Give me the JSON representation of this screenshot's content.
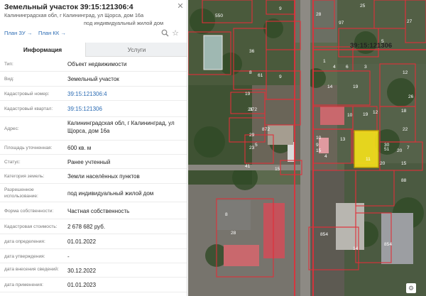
{
  "header": {
    "title": "Земельный участок 39:15:121306:4",
    "address_line1": "Калининградская обл, г Калининград, ул Щорса, дом 16а",
    "address_line2": "под индивидуальный жилой дом",
    "link_plan_zu": "План ЗУ →",
    "link_plan_kk": "План КК →"
  },
  "icons": {
    "close": "close-icon",
    "edit": "edit-icon",
    "star": "star-icon",
    "search": "search-icon"
  },
  "tabs": {
    "info": "Информация",
    "services": "Услуги"
  },
  "rows": [
    {
      "label": "Тип:",
      "value": "Объект недвижимости",
      "link": false
    },
    {
      "label": "Вид:",
      "value": "Земельный участок",
      "link": false
    },
    {
      "label": "Кадастровый номер:",
      "value": "39:15:121306:4",
      "link": true
    },
    {
      "label": "Кадастровый квартал:",
      "value": "39:15:121306",
      "link": true
    },
    {
      "label": "Адрес:",
      "value": "Калининградская обл, г Калининград, ул Щорса, дом 16а",
      "link": false
    },
    {
      "label": "Площадь уточненная:",
      "value": "600 кв. м",
      "link": false
    },
    {
      "label": "Статус:",
      "value": "Ранее учтенный",
      "link": false
    },
    {
      "label": "Категория земель:",
      "value": "Земли населённых пунктов",
      "link": false
    },
    {
      "label": "Разрешенное использование:",
      "value": "под индивидуальный жилой дом",
      "link": false
    },
    {
      "label": "Форма собственности:",
      "value": "Частная собственность",
      "link": false
    },
    {
      "label": "Кадастровая стоимость:",
      "value": "2 678 682 руб.",
      "link": false
    },
    {
      "label": "дата определения:",
      "value": "01.01.2022",
      "link": false
    },
    {
      "label": "дата утверждения:",
      "value": "-",
      "link": false
    },
    {
      "label": "дата внесения сведений:",
      "value": "30.12.2022",
      "link": false
    },
    {
      "label": "дата применения:",
      "value": "01.01.2023",
      "link": false
    }
  ],
  "map": {
    "cadastral_quarter_label": "39:15:121306",
    "plot_numbers": [
      "550",
      "9",
      "97",
      "25",
      "28",
      "27",
      "5",
      "1",
      "4",
      "6",
      "3",
      "36",
      "61",
      "8",
      "9",
      "19",
      "14",
      "19",
      "21",
      "12",
      "19",
      "372",
      "872",
      "20",
      "12",
      "13",
      "15",
      "11",
      "29",
      "26",
      "18",
      "10",
      "9",
      "22",
      "41",
      "15",
      "23",
      "5",
      "4",
      "7",
      "30",
      "14",
      "854",
      "854",
      "88",
      "28",
      "8",
      "51",
      "10",
      "15",
      "20"
    ],
    "colors": {
      "boundary": "#e0303a",
      "selected_fill": "#f5e21a",
      "selected_stroke": "#c8a400"
    }
  }
}
